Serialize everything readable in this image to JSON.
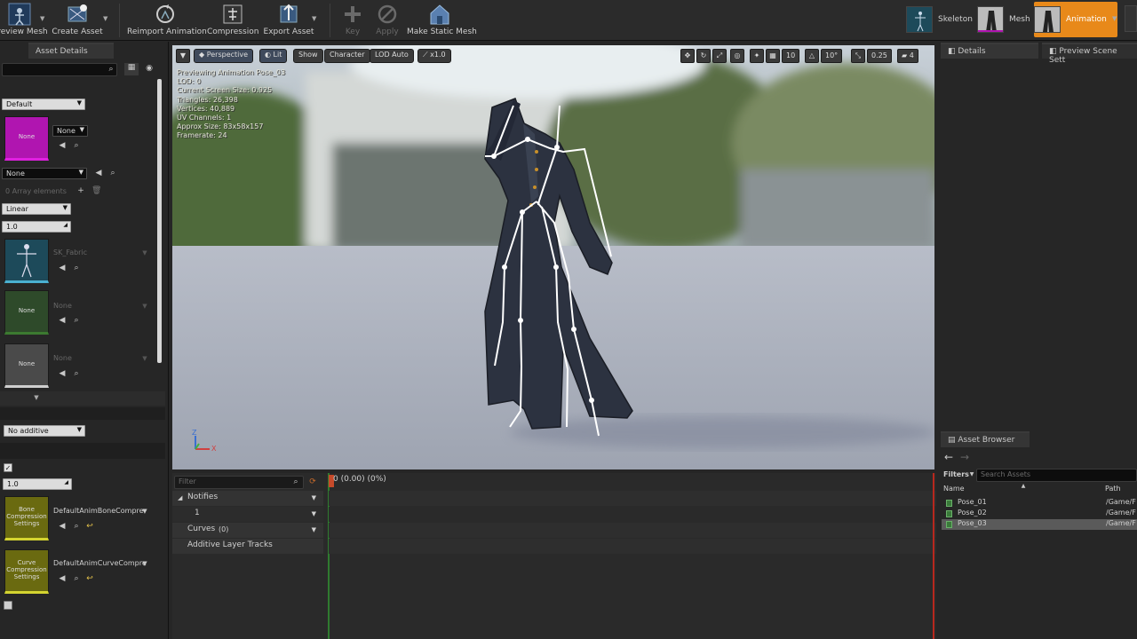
{
  "toolbar": {
    "items": [
      {
        "label": "Preview Mesh",
        "icon": "preview-mesh-icon",
        "has_dropdown": true
      },
      {
        "label": "Create Asset",
        "icon": "create-asset-icon",
        "has_dropdown": true
      },
      {
        "label": "Reimport Animation",
        "icon": "reimport-icon",
        "has_dropdown": false
      },
      {
        "label": "Compression",
        "icon": "compression-icon",
        "has_dropdown": false
      },
      {
        "label": "Export Asset",
        "icon": "export-icon",
        "has_dropdown": true
      },
      {
        "label": "Key",
        "icon": "key-icon",
        "disabled": true
      },
      {
        "label": "Apply",
        "icon": "apply-icon",
        "disabled": true
      },
      {
        "label": "Make Static Mesh",
        "icon": "make-static-mesh-icon"
      }
    ],
    "modes": {
      "skeleton": "Skeleton",
      "mesh": "Mesh",
      "animation": "Animation"
    }
  },
  "left_panel": {
    "tab_label": "Asset Details",
    "search_placeholder": "",
    "preview_pose_combo": "Default",
    "thumb_none_1": "None",
    "combo_none_1": "None",
    "combo_none_2": "None",
    "array_label": "0 Array elements",
    "interp_combo": "Linear",
    "rate_value": "1.0",
    "skeleton_name": "SK_Fabric",
    "thumb_none_2": "None",
    "combo_none_3": "None",
    "thumb_none_3": "None",
    "combo_none_4": "None",
    "additive_combo": "No additive",
    "scale_value": "1.0",
    "bone_comp_thumb": "Bone Compression Settings",
    "bone_comp_value": "DefaultAnimBoneCompre",
    "curve_comp_thumb": "Curve Compression Settings",
    "curve_comp_value": "DefaultAnimCurveCompre"
  },
  "viewport": {
    "view_mode": "Perspective",
    "lighting": "Lit",
    "show": "Show",
    "character": "Character",
    "lod": "LOD Auto",
    "speed": "x1.0",
    "grid_snap": "10",
    "rot_snap": "10°",
    "scale_snap": "0.25",
    "cam_speed": "4",
    "stats": [
      "Previewing Animation Pose_03",
      "LOD: 0",
      "Current Screen Size: 0.925",
      "Triangles: 26,398",
      "Vertices: 40,889",
      "UV Channels: 1",
      "Approx Size: 83x58x157",
      "Framerate: 24"
    ],
    "axis_z": "Z",
    "axis_x": "X"
  },
  "timeline": {
    "filter_placeholder": "Filter",
    "time_readout": "0 (0.00) (0%)",
    "notifies": "Notifies",
    "notify_track": "1",
    "curves": "Curves",
    "curves_count": "(0)",
    "additive": "Additive Layer Tracks"
  },
  "right_panel": {
    "details_tab": "Details",
    "preview_tab": "Preview Scene Sett",
    "asset_browser_tab": "Asset Browser",
    "filters": "Filters",
    "search_placeholder": "Search Assets",
    "col_name": "Name",
    "col_path": "Path",
    "assets": [
      {
        "name": "Pose_01",
        "path": "/Game/F"
      },
      {
        "name": "Pose_02",
        "path": "/Game/F"
      },
      {
        "name": "Pose_03",
        "path": "/Game/F"
      }
    ]
  },
  "colors": {
    "accent_orange": "#e8891a",
    "magenta_thumb": "#b015b0",
    "green_thumb": "#2e4a2a",
    "gray_thumb": "#4a4a4a",
    "yellow_thumb": "#6a6a10",
    "skeleton_thumb": "#1d4a5a"
  }
}
